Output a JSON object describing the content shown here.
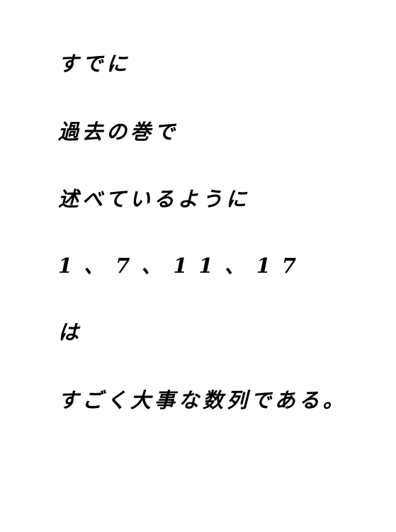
{
  "document": {
    "lines": [
      "すでに",
      "過去の巻で",
      "述べているように",
      "1、7、11、17",
      "は",
      "すごく大事な数列である。"
    ]
  }
}
